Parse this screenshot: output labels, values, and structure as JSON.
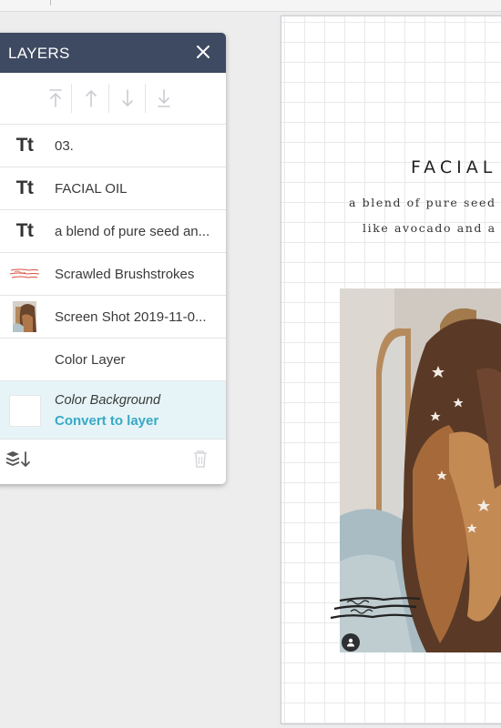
{
  "panel": {
    "title": "LAYERS",
    "arrange_icons": [
      "bring-to-front-icon",
      "bring-forward-icon",
      "send-backward-icon",
      "send-to-back-icon"
    ],
    "layers": [
      {
        "icon": "text-icon",
        "thumb_text": "Tt",
        "label": "03."
      },
      {
        "icon": "text-icon",
        "thumb_text": "Tt",
        "label": "FACIAL OIL"
      },
      {
        "icon": "text-icon",
        "thumb_text": "Tt",
        "label": "a blend of pure seed an..."
      },
      {
        "icon": "brushstroke-icon",
        "label": "Scrawled Brushstrokes"
      },
      {
        "icon": "image-thumbnail",
        "label": "Screen Shot 2019-11-0..."
      },
      {
        "icon": "none",
        "label": "Color Layer"
      }
    ],
    "selected_layer": {
      "label": "Color Background",
      "action": "Convert to layer",
      "swatch_color": "#ffffff"
    },
    "footer_icons": [
      "layers-sort-icon",
      "trash-icon"
    ]
  },
  "canvas": {
    "title": "FACIAL",
    "subtitle_line1": "a blend of pure seed",
    "subtitle_line2": "like avocado and a"
  },
  "colors": {
    "header": "#3e4a61",
    "accent": "#38a9c5",
    "selected_bg": "#e6f4f7"
  }
}
